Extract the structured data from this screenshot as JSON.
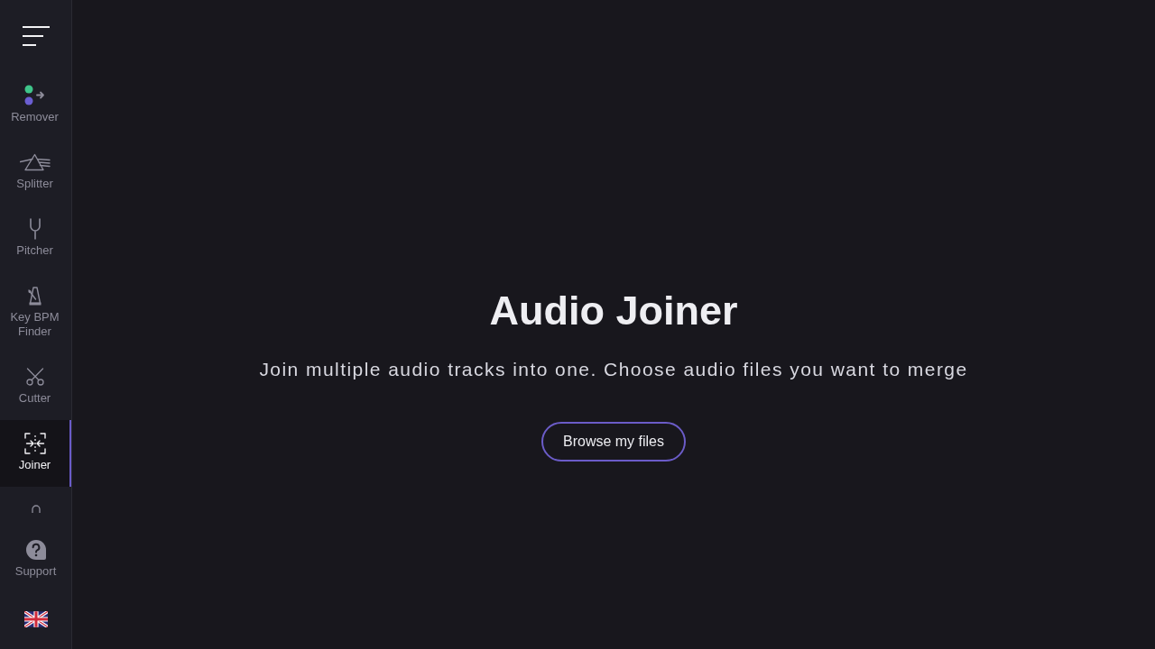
{
  "sidebar": {
    "tools": [
      {
        "label": "Remover",
        "selected": false
      },
      {
        "label": "Splitter",
        "selected": false
      },
      {
        "label": "Pitcher",
        "selected": false
      },
      {
        "label": "Key BPM Finder",
        "selected": false
      },
      {
        "label": "Cutter",
        "selected": false
      },
      {
        "label": "Joiner",
        "selected": true
      }
    ],
    "support": {
      "label": "Support"
    }
  },
  "main": {
    "title": "Audio Joiner",
    "subtitle": "Join multiple audio tracks into one. Choose audio files you want to merge",
    "button": "Browse my files"
  }
}
